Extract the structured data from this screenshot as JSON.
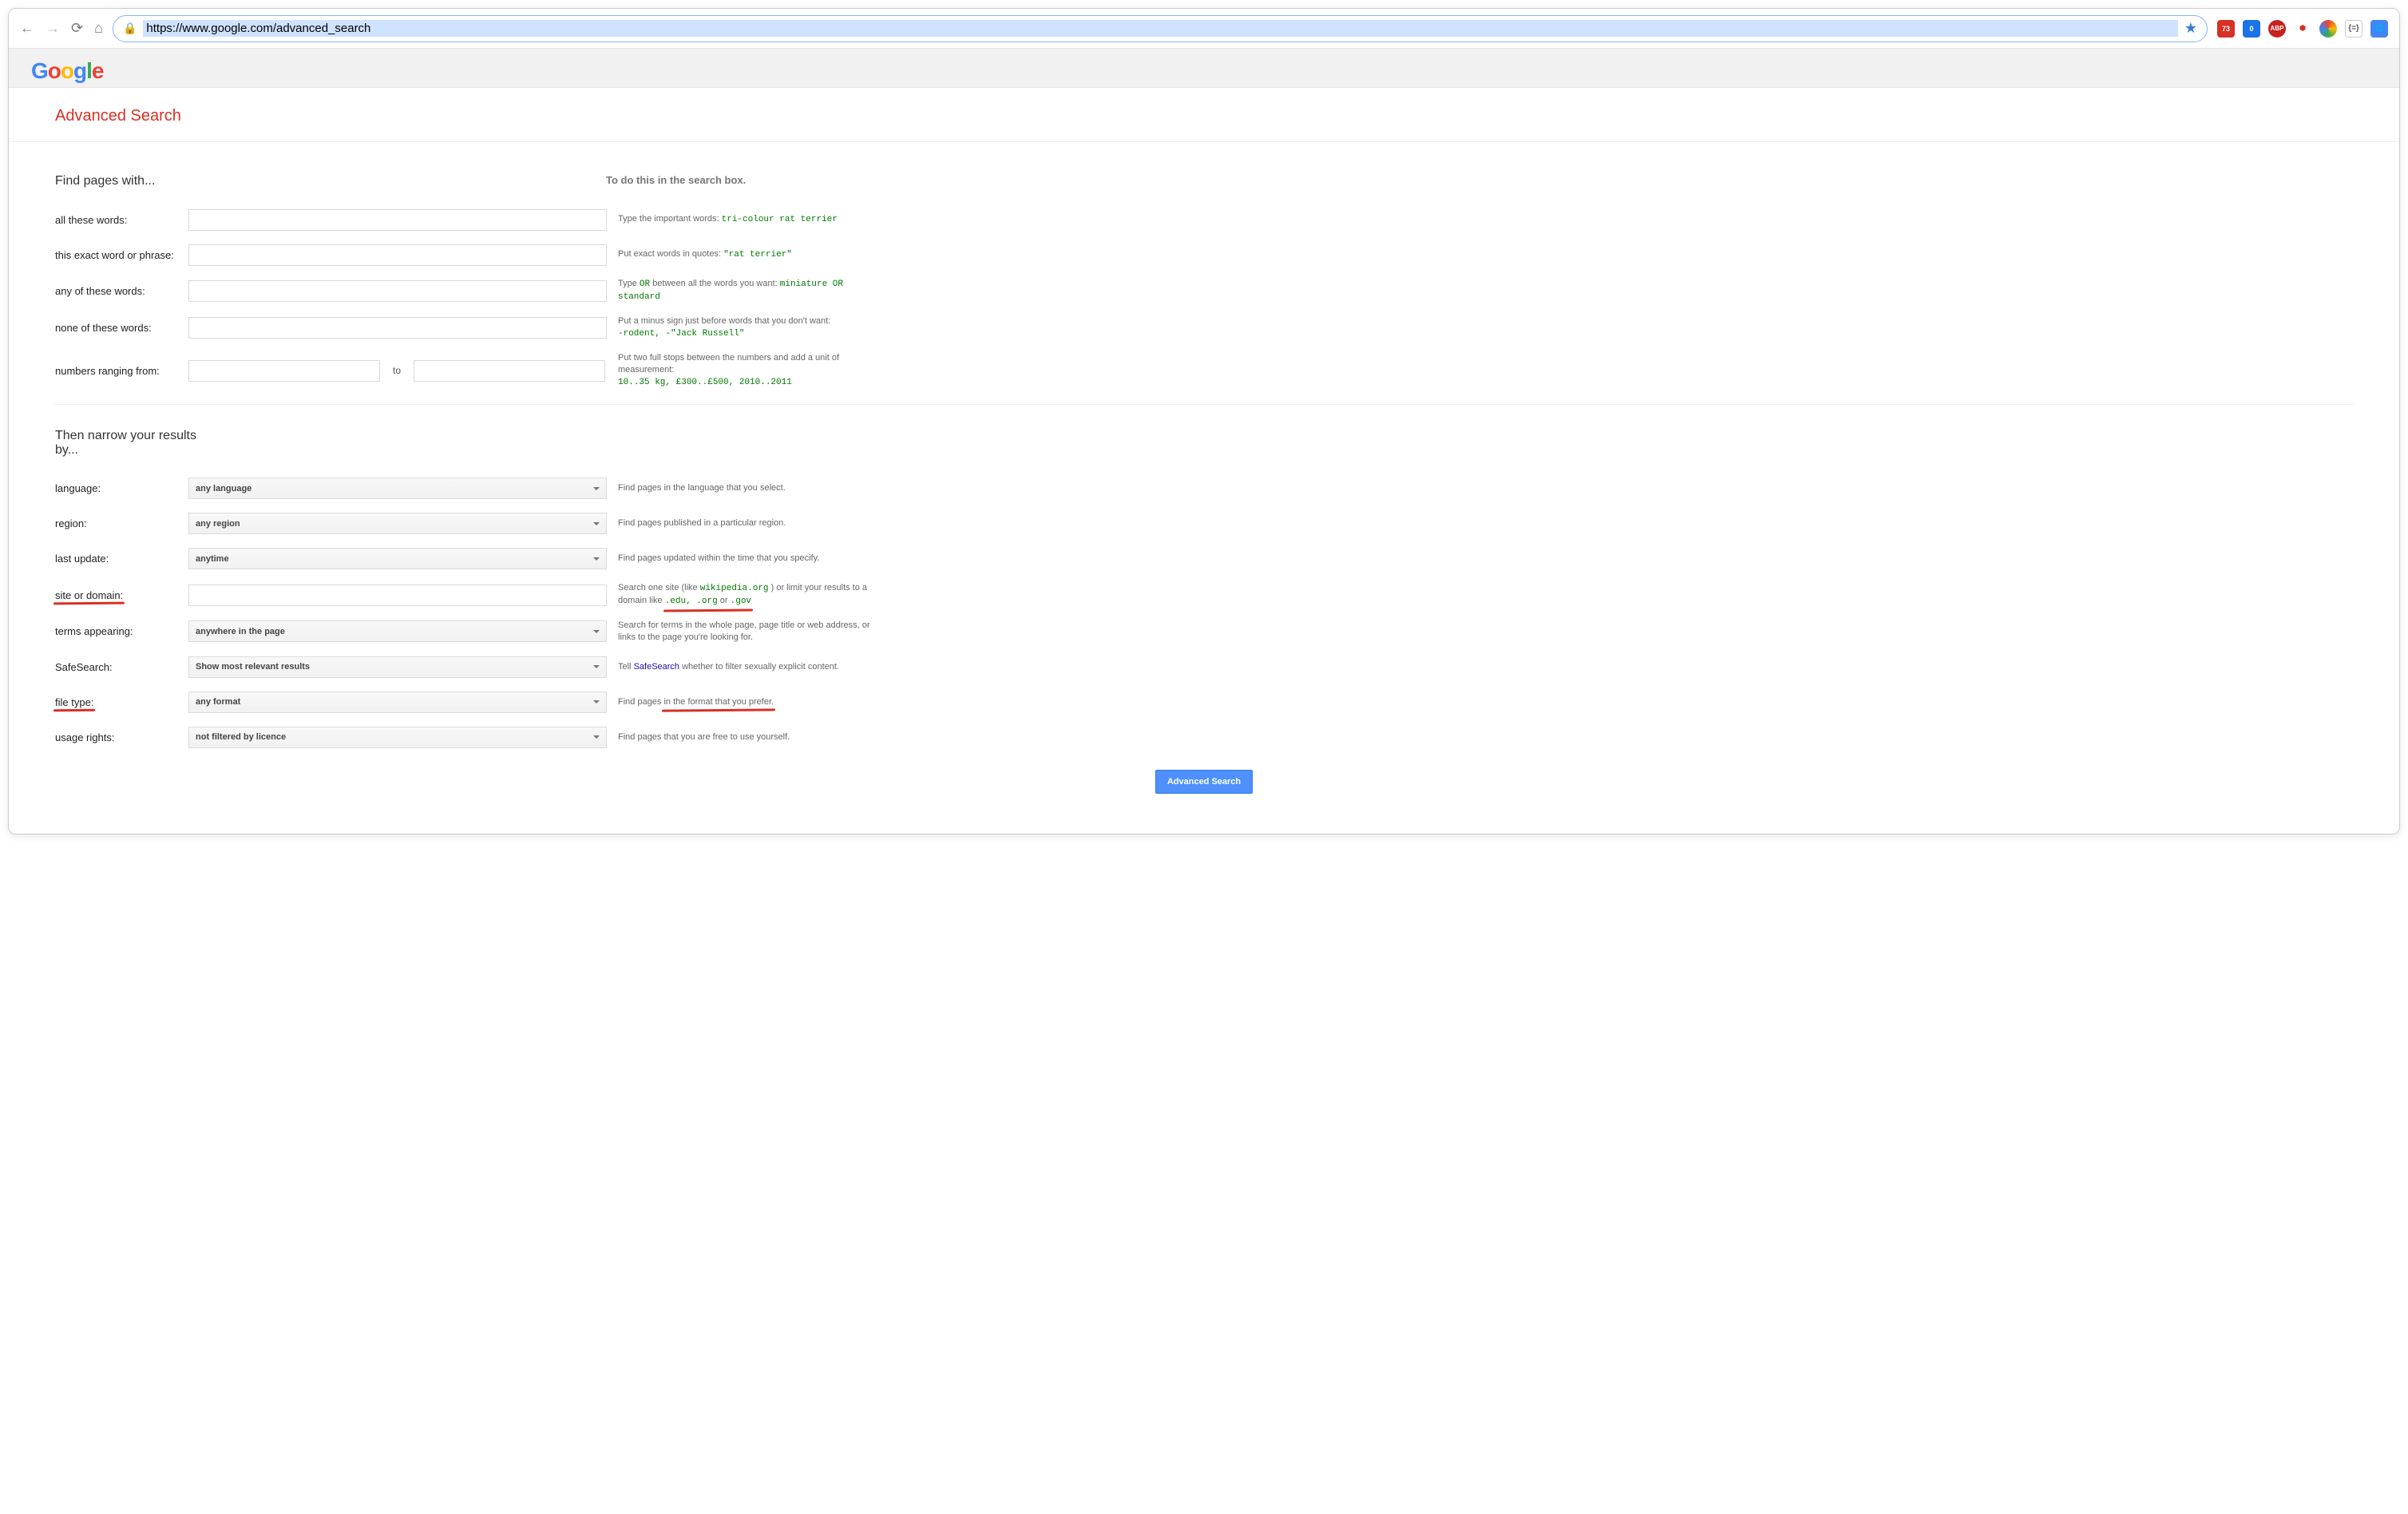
{
  "browser": {
    "url": "https://www.google.com/advanced_search",
    "ext_badges": [
      "73",
      "0",
      "ABP"
    ]
  },
  "logo_text": "Google",
  "page_title": "Advanced Search",
  "section_find": {
    "heading": "Find pages with...",
    "right_heading": "To do this in the search box.",
    "rows": {
      "all_words": {
        "label": "all these words:",
        "hint_prefix": "Type the important words:",
        "hint_code": "tri-colour rat terrier"
      },
      "exact": {
        "label": "this exact word or phrase:",
        "hint_prefix": "Put exact words in quotes:",
        "hint_code": "\"rat terrier\""
      },
      "any": {
        "label": "any of these words:",
        "hint_prefix": "Type",
        "hint_mid": "between all the words you want:",
        "hint_code_or": "OR",
        "hint_code": "miniature OR standard"
      },
      "none": {
        "label": "none of these words:",
        "hint_prefix": "Put a minus sign just before words that you don't want:",
        "hint_code": "-rodent, -\"Jack Russell\""
      },
      "numbers": {
        "label": "numbers ranging from:",
        "to": "to",
        "hint_prefix": "Put two full stops between the numbers and add a unit of measurement:",
        "hint_code": "10..35 kg, £300..£500, 2010..2011"
      }
    }
  },
  "section_narrow": {
    "heading": "Then narrow your results by...",
    "rows": {
      "language": {
        "label": "language:",
        "value": "any language",
        "hint": "Find pages in the language that you select."
      },
      "region": {
        "label": "region:",
        "value": "any region",
        "hint": "Find pages published in a particular region."
      },
      "last_update": {
        "label": "last update:",
        "value": "anytime",
        "hint": "Find pages updated within the time that you specify."
      },
      "site": {
        "label": "site or domain:",
        "hint_prefix": "Search one site (like ",
        "hint_code1": "wikipedia.org",
        "hint_mid": " ) or limit your results to a domain like ",
        "hint_code2": ".edu, .org",
        "hint_mid2": " or ",
        "hint_code3": ".gov"
      },
      "terms": {
        "label": "terms appearing:",
        "value": "anywhere in the page",
        "hint": "Search for terms in the whole page, page title or web address, or links to the page you're looking for."
      },
      "safesearch": {
        "label": "SafeSearch",
        "label_suffix": ":",
        "value": "Show most relevant results",
        "hint_prefix": "Tell ",
        "hint_link": "SafeSearch",
        "hint_suffix": " whether to filter sexually explicit content."
      },
      "filetype": {
        "label": "file type:",
        "value": "any format",
        "hint_prefix": "Find pages ",
        "hint_underlined": "in the format that you prefer.",
        "hint_suffix": ""
      },
      "usage": {
        "label": "usage rights",
        "label_suffix": ":",
        "value": "not filtered by licence",
        "hint": "Find pages that you are free to use yourself."
      }
    }
  },
  "submit_label": "Advanced Search"
}
